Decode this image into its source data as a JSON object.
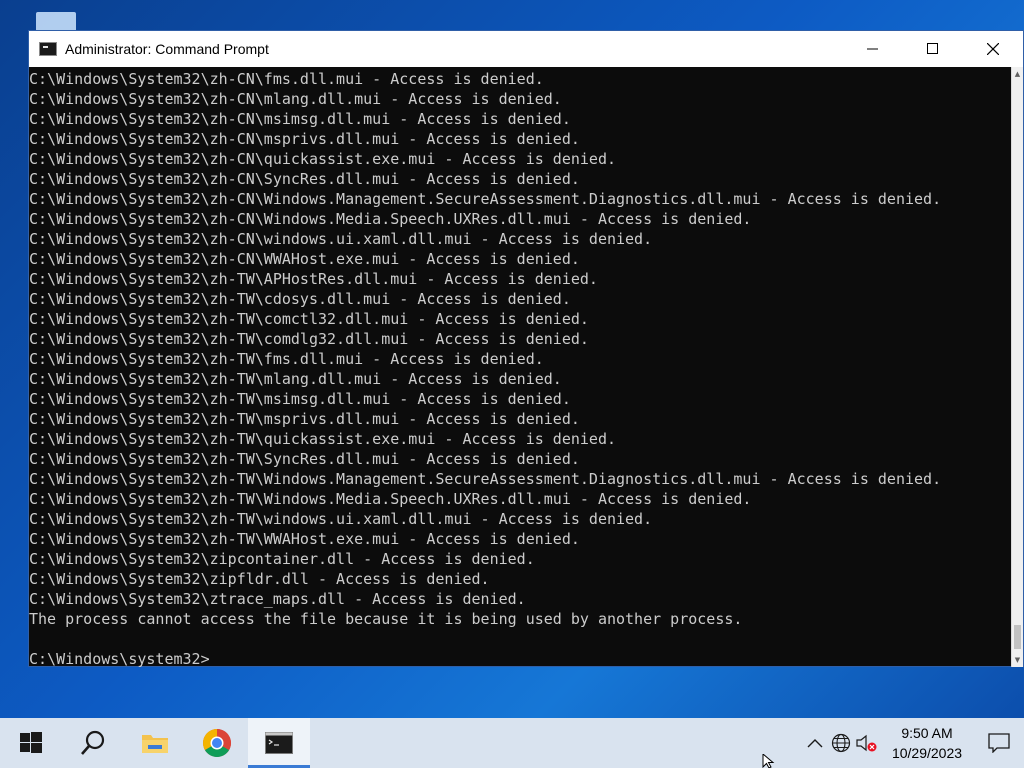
{
  "window": {
    "title": "Administrator: Command Prompt"
  },
  "console": {
    "lines": [
      "C:\\Windows\\System32\\zh-CN\\fms.dll.mui - Access is denied.",
      "C:\\Windows\\System32\\zh-CN\\mlang.dll.mui - Access is denied.",
      "C:\\Windows\\System32\\zh-CN\\msimsg.dll.mui - Access is denied.",
      "C:\\Windows\\System32\\zh-CN\\msprivs.dll.mui - Access is denied.",
      "C:\\Windows\\System32\\zh-CN\\quickassist.exe.mui - Access is denied.",
      "C:\\Windows\\System32\\zh-CN\\SyncRes.dll.mui - Access is denied.",
      "C:\\Windows\\System32\\zh-CN\\Windows.Management.SecureAssessment.Diagnostics.dll.mui - Access is denied.",
      "C:\\Windows\\System32\\zh-CN\\Windows.Media.Speech.UXRes.dll.mui - Access is denied.",
      "C:\\Windows\\System32\\zh-CN\\windows.ui.xaml.dll.mui - Access is denied.",
      "C:\\Windows\\System32\\zh-CN\\WWAHost.exe.mui - Access is denied.",
      "C:\\Windows\\System32\\zh-TW\\APHostRes.dll.mui - Access is denied.",
      "C:\\Windows\\System32\\zh-TW\\cdosys.dll.mui - Access is denied.",
      "C:\\Windows\\System32\\zh-TW\\comctl32.dll.mui - Access is denied.",
      "C:\\Windows\\System32\\zh-TW\\comdlg32.dll.mui - Access is denied.",
      "C:\\Windows\\System32\\zh-TW\\fms.dll.mui - Access is denied.",
      "C:\\Windows\\System32\\zh-TW\\mlang.dll.mui - Access is denied.",
      "C:\\Windows\\System32\\zh-TW\\msimsg.dll.mui - Access is denied.",
      "C:\\Windows\\System32\\zh-TW\\msprivs.dll.mui - Access is denied.",
      "C:\\Windows\\System32\\zh-TW\\quickassist.exe.mui - Access is denied.",
      "C:\\Windows\\System32\\zh-TW\\SyncRes.dll.mui - Access is denied.",
      "C:\\Windows\\System32\\zh-TW\\Windows.Management.SecureAssessment.Diagnostics.dll.mui - Access is denied.",
      "C:\\Windows\\System32\\zh-TW\\Windows.Media.Speech.UXRes.dll.mui - Access is denied.",
      "C:\\Windows\\System32\\zh-TW\\windows.ui.xaml.dll.mui - Access is denied.",
      "C:\\Windows\\System32\\zh-TW\\WWAHost.exe.mui - Access is denied.",
      "C:\\Windows\\System32\\zipcontainer.dll - Access is denied.",
      "C:\\Windows\\System32\\zipfldr.dll - Access is denied.",
      "C:\\Windows\\System32\\ztrace_maps.dll - Access is denied.",
      "The process cannot access the file because it is being used by another process.",
      "",
      "C:\\Windows\\system32>"
    ]
  },
  "taskbar": {
    "clock_time": "9:50 AM",
    "clock_date": "10/29/2023"
  },
  "colors": {
    "console_bg": "#0c0c0c",
    "console_text": "#cccccc",
    "taskbar_bg": "#d9e3ef",
    "accent": "#3a7bd5"
  },
  "icons": {
    "start": "windows-logo-icon",
    "search": "search-icon",
    "explorer": "folder-icon",
    "chrome": "chrome-icon",
    "cmd": "command-prompt-icon",
    "tray_overflow": "chevron-up-icon",
    "network": "globe-icon",
    "volume": "speaker-muted-icon",
    "notifications": "notification-icon"
  }
}
